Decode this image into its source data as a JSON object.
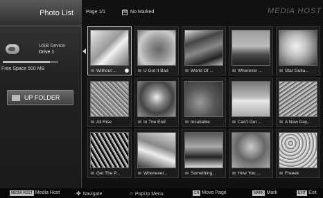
{
  "left_panel": {
    "title": "Photo List",
    "device_label": "USB Device",
    "drive_label": "Drive 1",
    "free_space": "Free Space 500 MB",
    "free_space_fraction": 0.85,
    "up_folder_label": "UP FOLDER"
  },
  "header": {
    "page": "Page 1/1",
    "marked": "No Marked",
    "brand": "MEDIA HOST"
  },
  "thumbnails": [
    {
      "caption": "Without ...",
      "selected": true
    },
    {
      "caption": "U Got It Bad",
      "selected": false
    },
    {
      "caption": "World Of ...",
      "selected": false
    },
    {
      "caption": "Wherever ...",
      "selected": false
    },
    {
      "caption": "Star Guita...",
      "selected": false
    },
    {
      "caption": "All Rise",
      "selected": false
    },
    {
      "caption": "In The End",
      "selected": false
    },
    {
      "caption": "Insatiable",
      "selected": false
    },
    {
      "caption": "Can't Get ...",
      "selected": false
    },
    {
      "caption": "A New Day...",
      "selected": false
    },
    {
      "caption": "Get The P...",
      "selected": false
    },
    {
      "caption": "Whenever...",
      "selected": false
    },
    {
      "caption": "Something...",
      "selected": false
    },
    {
      "caption": "How You ...",
      "selected": false
    },
    {
      "caption": "Freeek",
      "selected": false
    }
  ],
  "footer": {
    "media_host_key": "MEDIA HOST",
    "media_host": "Media Host",
    "navigate": "Navigate",
    "popup_menu": "PopUp Menu",
    "ch_key": "CH",
    "move_page": "Move Page",
    "mark_key": "MARK",
    "mark": "Mark",
    "exit_key": "EXIT",
    "exit": "Exit"
  }
}
